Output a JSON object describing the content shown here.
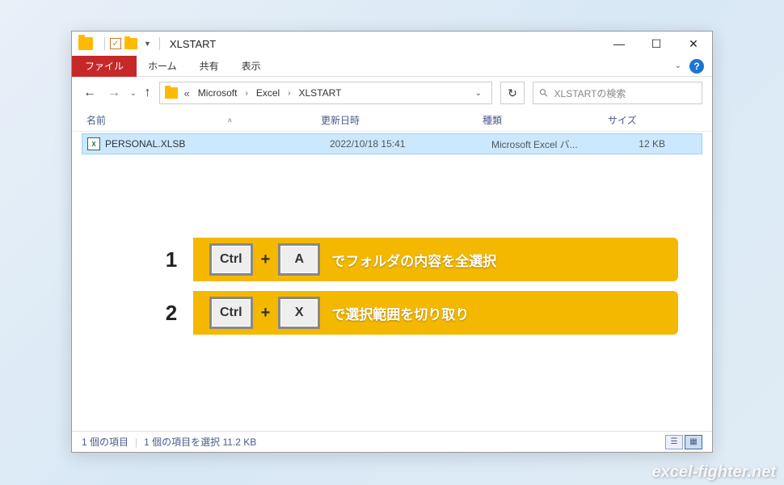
{
  "titlebar": {
    "title": "XLSTART"
  },
  "ribbon": {
    "file": "ファイル",
    "home": "ホーム",
    "share": "共有",
    "view": "表示",
    "help": "?"
  },
  "breadcrumb": {
    "p1": "Microsoft",
    "p2": "Excel",
    "p3": "XLSTART"
  },
  "search": {
    "placeholder": "XLSTARTの検索"
  },
  "columns": {
    "name": "名前",
    "date": "更新日時",
    "type": "種類",
    "size": "サイズ"
  },
  "file": {
    "name": "PERSONAL.XLSB",
    "date": "2022/10/18 15:41",
    "type": "Microsoft Excel バ...",
    "size": "12 KB"
  },
  "status": {
    "count": "1 個の項目",
    "selected": "1 個の項目を選択  11.2 KB"
  },
  "banners": [
    {
      "num": "1",
      "k1": "Ctrl",
      "k2": "A",
      "desc": "でフォルダの内容を全選択"
    },
    {
      "num": "2",
      "k1": "Ctrl",
      "k2": "X",
      "desc": "で選択範囲を切り取り"
    }
  ],
  "watermark": "excel-fighter.net"
}
